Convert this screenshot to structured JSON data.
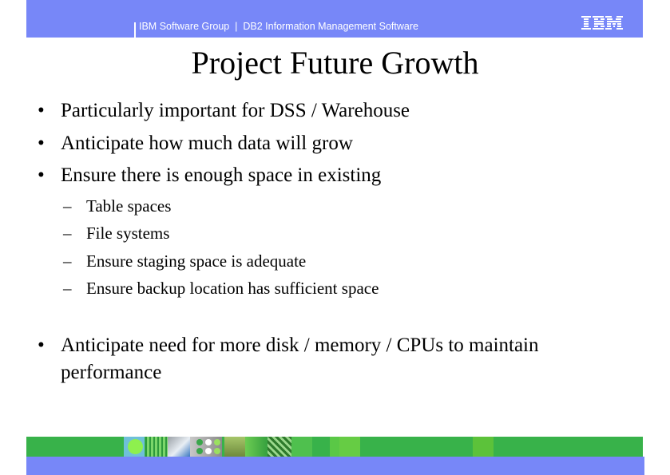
{
  "header": {
    "group": "IBM Software Group",
    "separator": "|",
    "product": "DB2 Information Management Software",
    "text": "IBM Software Group  |  DB2 Information Management Software",
    "logo_icon": "ibm-logo",
    "bar_color": "#7787f8"
  },
  "slide": {
    "title": "Project Future Growth",
    "bullets": [
      {
        "text": "Particularly important for DSS / Warehouse"
      },
      {
        "text": "Anticipate how much data will grow"
      },
      {
        "text": "Ensure there is enough space in existing",
        "sub": [
          "Table spaces",
          "File systems",
          "Ensure staging space is adequate",
          "Ensure backup location has sufficient space"
        ]
      },
      {
        "text": "Anticipate need for more disk / memory / CPUs to maintain",
        "continuation": "performance"
      }
    ],
    "bullet_glyph": "•",
    "sub_glyph": "–"
  },
  "footer": {
    "green_color": "#38b24a",
    "blue_color": "#7787f8",
    "decoration_icon": "image-strip"
  }
}
